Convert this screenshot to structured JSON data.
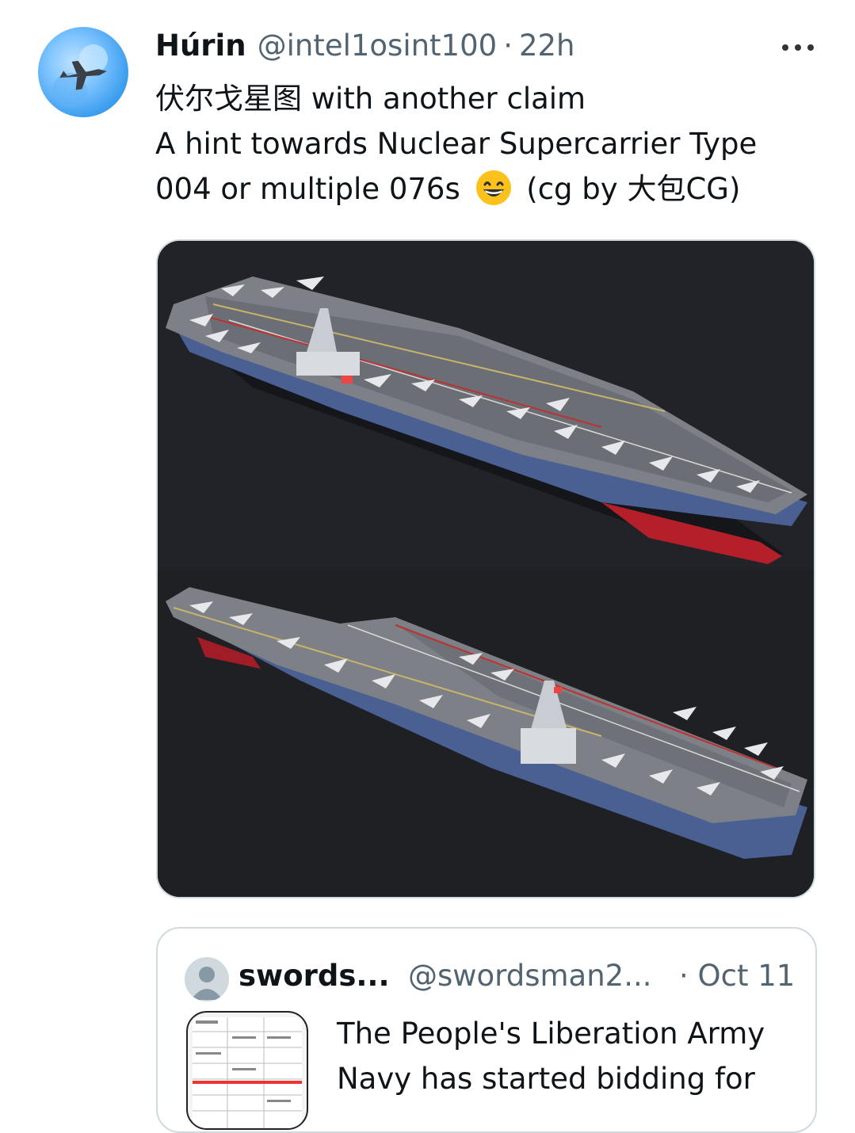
{
  "tweet": {
    "author_name": "Húrin",
    "author_handle": "@intel1osint100",
    "separator": "·",
    "time": "22h",
    "text_lines": [
      "伏尔戈星图 with another claim",
      "A hint towards Nuclear Supercarrier Type",
      "004 or multiple 076s",
      "(cg by 大包CG)"
    ],
    "emoji": "grinning-face-emoji",
    "more_icon": "more-options-icon"
  },
  "quoted": {
    "author_name": "swords...",
    "author_handle": "@swordsman2...",
    "time": "· Oct 11",
    "text_lines": [
      "The People's Liberation Army",
      "Navy has started bidding for"
    ]
  },
  "colors": {
    "secondary_text": "#536471",
    "border": "#cfd9de",
    "media_bg": "#1f2125"
  }
}
